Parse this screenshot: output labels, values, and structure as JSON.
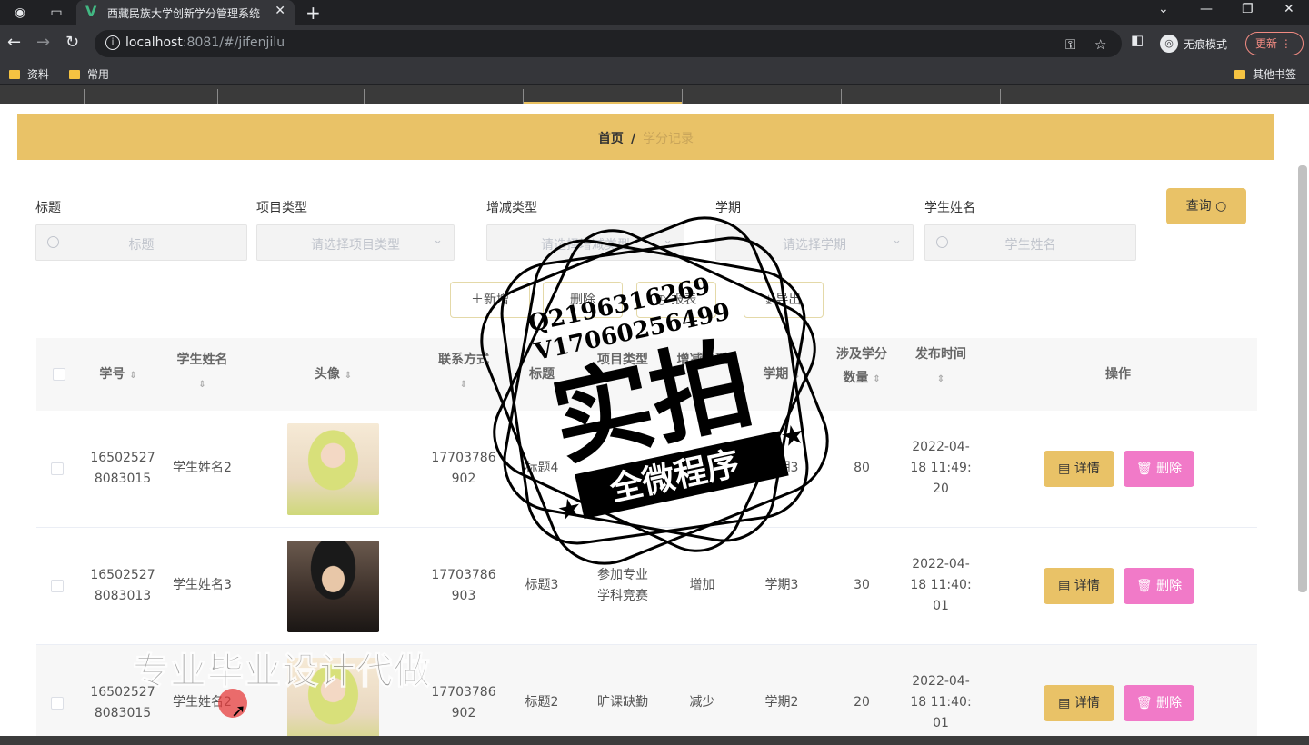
{
  "browser": {
    "tab_title": "西藏民族大学创新学分管理系统",
    "url_host": "localhost",
    "url_path": ":8081/#/jifenjilu",
    "incognito_label": "无痕模式",
    "update_label": "更新",
    "bookmarks": [
      "资料",
      "常用"
    ],
    "other_bookmarks": "其他书签"
  },
  "breadcrumb": {
    "home": "首页",
    "separator": "/",
    "current": "学分记录"
  },
  "filters": {
    "title_label": "标题",
    "title_placeholder": "标题",
    "project_type_label": "项目类型",
    "project_type_placeholder": "请选择项目类型",
    "change_type_label": "增减类型",
    "change_type_placeholder": "请选择增减类型",
    "semester_label": "学期",
    "semester_placeholder": "请选择学期",
    "student_name_label": "学生姓名",
    "student_name_placeholder": "学生姓名",
    "query_button": "查询"
  },
  "actions": {
    "add": "新增",
    "delete": "删除",
    "report": "报表",
    "export": "导出"
  },
  "table": {
    "headers": {
      "student_id": "学号",
      "student_name": "学生姓名",
      "avatar": "头像",
      "contact": "联系方式",
      "title": "标题",
      "project_type": "项目类型",
      "change_type": "增减类型",
      "semester": "学期",
      "credits_a": "涉及学分",
      "credits_b": "数量",
      "publish_time": "发布时间",
      "ops": "操作"
    },
    "rows": [
      {
        "id_a": "16502527",
        "id_b": "8083015",
        "name": "学生姓名2",
        "phone_a": "17703786",
        "phone_b": "902",
        "title": "标题4",
        "type_a": "",
        "type_b": "",
        "change": "",
        "semester": "学期3",
        "credits": "80",
        "time_a": "2022-04-",
        "time_b": "18 11:49:",
        "time_c": "20"
      },
      {
        "id_a": "16502527",
        "id_b": "8083013",
        "name": "学生姓名3",
        "phone_a": "17703786",
        "phone_b": "903",
        "title": "标题3",
        "type_a": "参加专业",
        "type_b": "学科竞赛",
        "change": "增加",
        "semester": "学期3",
        "credits": "30",
        "time_a": "2022-04-",
        "time_b": "18 11:40:",
        "time_c": "01"
      },
      {
        "id_a": "16502527",
        "id_b": "8083015",
        "name": "学生姓名2",
        "phone_a": "17703786",
        "phone_b": "902",
        "title": "标题2",
        "type_a": "旷课缺勤",
        "type_b": "",
        "change": "减少",
        "semester": "学期2",
        "credits": "20",
        "time_a": "2022-04-",
        "time_b": "18 11:40:",
        "time_c": "01"
      }
    ],
    "detail_label": "详情",
    "delete_label": "删除"
  },
  "watermark": {
    "qq": "Q2196316269",
    "wechat": "V17060256499",
    "big": "实拍",
    "banner": "全微程序",
    "caption": "专业毕业设计代做"
  }
}
